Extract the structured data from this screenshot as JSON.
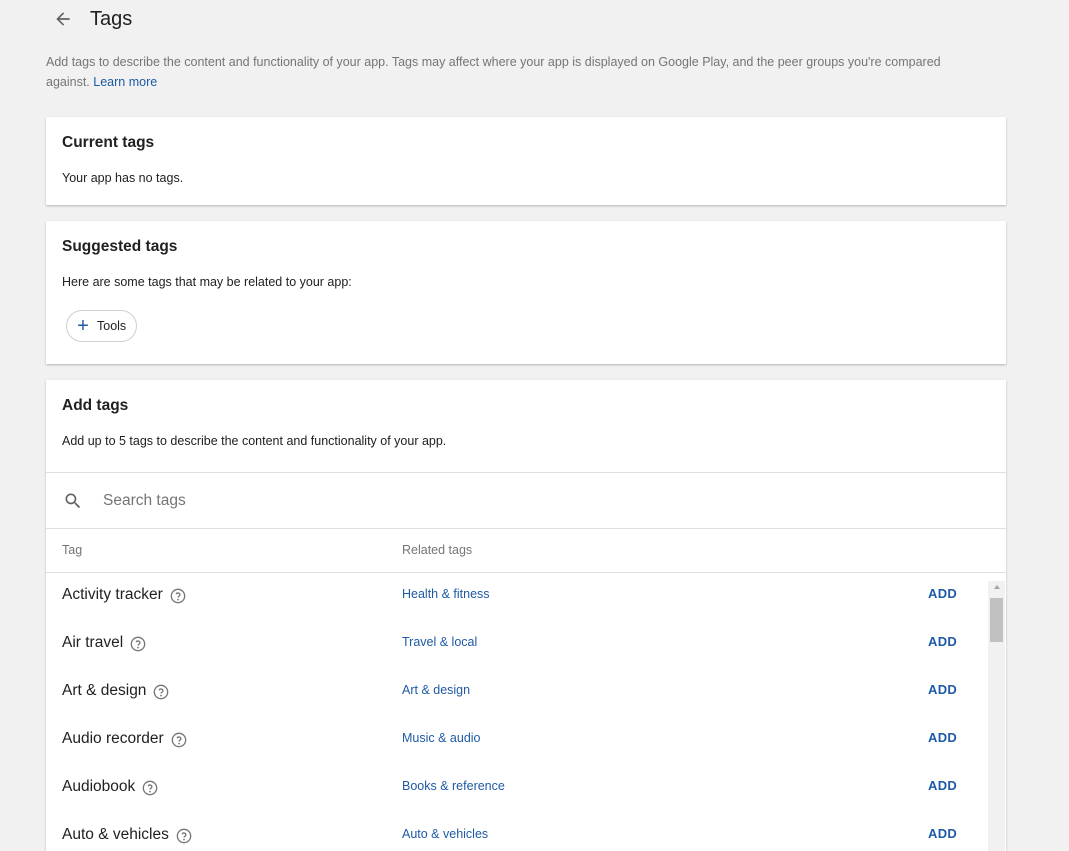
{
  "header": {
    "back_icon": "arrow-left-icon",
    "title": "Tags"
  },
  "intro": {
    "text": "Add tags to describe the content and functionality of your app. Tags may affect where your app is displayed on Google Play, and the peer groups you're compared against.",
    "link": "Learn more"
  },
  "current_tags": {
    "title": "Current tags",
    "text": "Your app has no tags."
  },
  "suggested_tags": {
    "title": "Suggested tags",
    "text": "Here are some tags that may be related to your app:",
    "chips": [
      {
        "label": "Tools",
        "icon": "plus-icon"
      }
    ]
  },
  "add_tags": {
    "title": "Add tags",
    "text": "Add up to 5 tags to describe the content and functionality of your app.",
    "search": {
      "placeholder": "Search tags",
      "value": "",
      "icon": "search-icon"
    },
    "columns": {
      "tag": "Tag",
      "related": "Related tags"
    },
    "add_label": "ADD",
    "rows": [
      {
        "tag": "Activity tracker",
        "related": "Health & fitness"
      },
      {
        "tag": "Air travel",
        "related": "Travel & local"
      },
      {
        "tag": "Art & design",
        "related": "Art & design"
      },
      {
        "tag": "Audio recorder",
        "related": "Music & audio"
      },
      {
        "tag": "Audiobook",
        "related": "Books & reference"
      },
      {
        "tag": "Auto & vehicles",
        "related": "Auto & vehicles"
      }
    ]
  },
  "colors": {
    "background": "#f1f1f1",
    "card": "#ffffff",
    "link": "#1f5aa6",
    "text": "#212121",
    "muted": "#757575"
  }
}
